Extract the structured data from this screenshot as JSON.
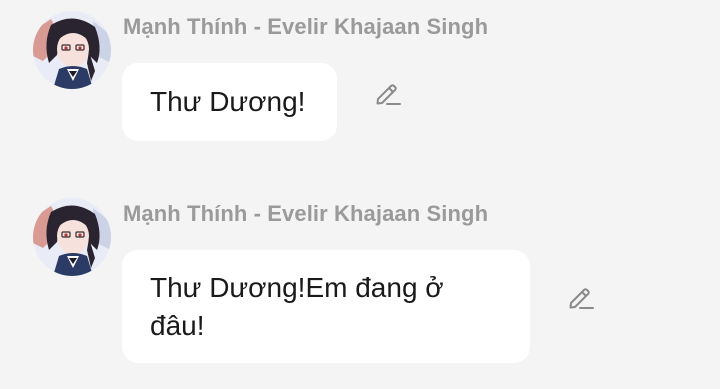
{
  "messages": [
    {
      "sender": "Mạnh Thính - Evelir Khajaan Singh",
      "text": "Thư Dương!",
      "avatar_icon": "avatar-anime-girl-icon",
      "edit_icon": "pencil-icon"
    },
    {
      "sender": "Mạnh Thính - Evelir Khajaan Singh",
      "text": "Thư Dương!Em đang ở đâu!",
      "avatar_icon": "avatar-anime-girl-icon",
      "edit_icon": "pencil-icon"
    }
  ],
  "colors": {
    "background": "#f4f4f4",
    "bubble": "#ffffff",
    "sender_text": "#9a9a9a",
    "message_text": "#1a1a1a",
    "icon": "#8a8a8a"
  }
}
